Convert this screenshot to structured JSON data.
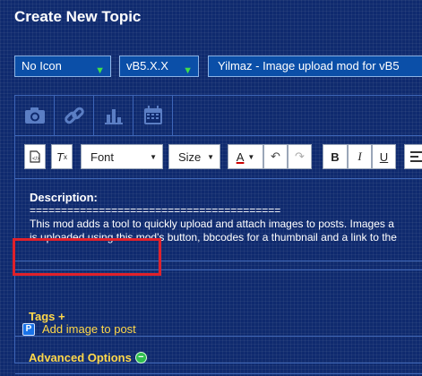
{
  "header": {
    "title": "Create New Topic"
  },
  "form": {
    "icon_select": "No Icon",
    "version_select": "vB5.X.X",
    "subject": "Yilmaz - Image upload mod for vB5"
  },
  "attachments": {
    "icons": [
      "camera-icon",
      "link-icon",
      "chart-icon",
      "calendar-icon"
    ]
  },
  "toolbar": {
    "font_label": "Font",
    "size_label": "Size",
    "color_label": "A",
    "bold_label": "B",
    "italic_label": "I",
    "underline_label": "U",
    "icons": [
      "source-icon",
      "clear-format-icon",
      "undo-icon",
      "redo-icon",
      "align-left-icon"
    ]
  },
  "body": {
    "heading": "Description:",
    "rule": "========================================",
    "line1": "This mod adds a tool to quickly upload and attach images to posts. Images a",
    "line2": "is uploaded using this mod's button, bbcodes for a thumbnail and a link to the"
  },
  "add_image": {
    "label": "Add image to post",
    "icon_letter": "P"
  },
  "tags": {
    "label": "Tags +"
  },
  "advanced": {
    "label": "Advanced Options",
    "toggle": "−"
  },
  "colors": {
    "accent_yellow": "#ffd84a",
    "highlight_red": "#e0212b",
    "select_bg": "#0b4fa8"
  }
}
